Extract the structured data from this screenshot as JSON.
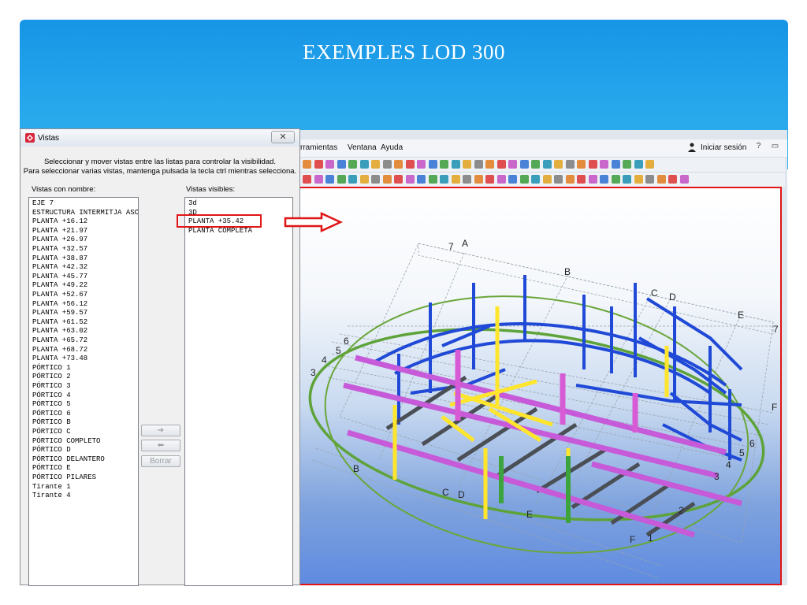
{
  "slide": {
    "title": "EXEMPLES  LOD 300"
  },
  "app": {
    "menu": [
      "rramientas",
      "Ventana",
      "Ayuda"
    ],
    "login_label": "Iniciar sesión",
    "window_buttons": [
      "?",
      "▭"
    ]
  },
  "dialog": {
    "title": "Vistas",
    "close_label": "✕",
    "instruction_line1": "Seleccionar y mover vistas entre las listas para controlar la visibilidad.",
    "instruction_line2": "Para seleccionar varias vistas, mantenga pulsada la tecla ctrl mientras selecciona.",
    "named_label": "Vistas con nombre:",
    "visible_label": "Vistas visibles:",
    "named_views": [
      "EJE 7",
      "ESTRUCTURA INTERMITJA ASC",
      "PLANTA +16.12",
      "PLANTA +21.97",
      "PLANTA +26.97",
      "PLANTA +32.57",
      "PLANTA +38.87",
      "PLANTA +42.32",
      "PLANTA +45.77",
      "PLANTA +49.22",
      "PLANTA +52.67",
      "PLANTA +56.12",
      "PLANTA +59.57",
      "PLANTA +61.52",
      "PLANTA +63.02",
      "PLANTA +65.72",
      "PLANTA +68.72",
      "PLANTA +73.48",
      "PÓRTICO 1",
      "PÓRTICO 2",
      "PÓRTICO 3",
      "PÓRTICO 4",
      "PÓRTICO 5",
      "PÓRTICO 6",
      "PÓRTICO B",
      "PÓRTICO C",
      "PÓRTICO COMPLETO",
      "PÓRTICO D",
      "PÓRTICO DELANTERO",
      "PÓRTICO E",
      "PÓRTICO PILARES",
      "Tirante 1",
      "Tirante 4"
    ],
    "visible_views": [
      "3d",
      "3D",
      "PLANTA +35.42",
      "PLANTA COMPLETA"
    ],
    "add_button": "➔",
    "remove_button": "⬅",
    "delete_button": "Borrar"
  },
  "model": {
    "axis_labels": {
      "a": "A",
      "b": "B",
      "c": "C",
      "d": "D",
      "e": "E",
      "f": "F",
      "n1": "1",
      "n2": "2",
      "n3": "3",
      "n4": "4",
      "n5": "5",
      "n6": "6",
      "n7": "7"
    }
  },
  "colors": {
    "accent_red": "#e01515",
    "header_blue": "#1f9ee9"
  }
}
